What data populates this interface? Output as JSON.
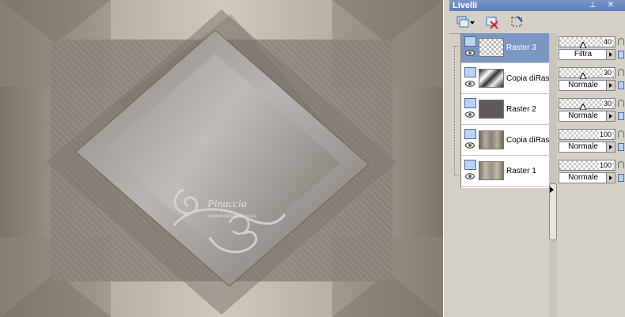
{
  "canvas": {
    "watermark_name": "Pinuccia",
    "watermark_url": "www.moidiregraf.co.eu"
  },
  "panel": {
    "title": "Livelli",
    "pin_icon": "pin-icon",
    "close_icon": "close-icon",
    "menu_icon": "menu-icon"
  },
  "toolbar": {
    "icons": [
      "new-layer-icon",
      "delete-layer-icon",
      "mask-icon"
    ]
  },
  "layers": [
    {
      "name": "Raster 3",
      "selected": true,
      "thumb": "checker-art",
      "opacity": "40",
      "blend": "Filtra"
    },
    {
      "name": "Copia diRaster",
      "selected": false,
      "thumb": "checker-bw",
      "opacity": "30",
      "blend": "Normale"
    },
    {
      "name": "Raster 2",
      "selected": false,
      "thumb": "dark-gray",
      "opacity": "30",
      "blend": "Normale"
    },
    {
      "name": "Copia diRaster",
      "selected": false,
      "thumb": "beige-gradient",
      "opacity": "100",
      "blend": "Normale"
    },
    {
      "name": "Raster 1",
      "selected": false,
      "thumb": "beige-gradient",
      "opacity": "100",
      "blend": "Normale"
    }
  ],
  "colors": {
    "selection": "#7b96c2",
    "titlebar": "#6b88bf",
    "panel": "#d4d0c8"
  }
}
